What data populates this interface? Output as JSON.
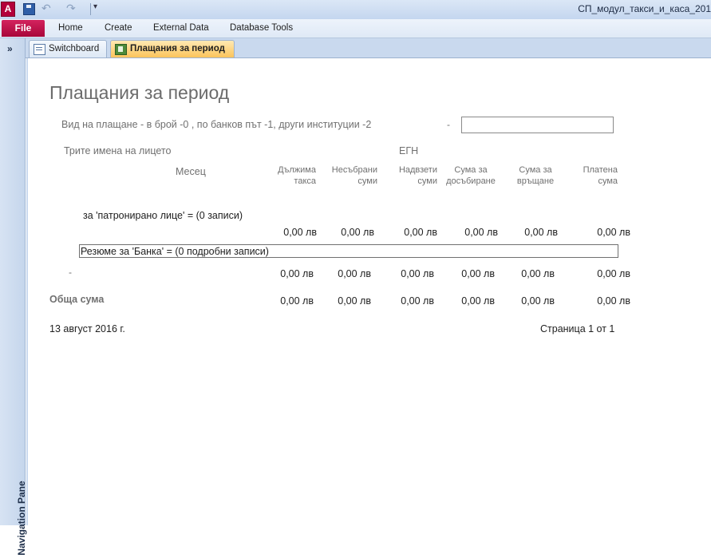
{
  "window": {
    "title": "СП_модул_такси_и_каса_201",
    "app_icon_letter": "A"
  },
  "quick_access": {
    "undo_glyph": "↶",
    "redo_glyph": "↷",
    "customize_glyph": "▾"
  },
  "ribbon": {
    "file_label": "File",
    "tabs": [
      "Home",
      "Create",
      "External Data",
      "Database Tools"
    ]
  },
  "nav_pane": {
    "label": "Navigation Pane",
    "toggle_glyph": "»"
  },
  "document_tabs": [
    {
      "label": "Switchboard",
      "active": false
    },
    {
      "label": "Плащания за период",
      "active": true
    }
  ],
  "report": {
    "title": "Плащания за период",
    "payment_type_label": "Вид на плащане - в брой -0 , по банков път -1, други институции -2",
    "payment_type_dash": "-",
    "payment_type_value": "",
    "columns": {
      "names": "Трите имена на лицето",
      "egn": "ЕГН",
      "month": "Месец",
      "due_line1": "Дължима",
      "due_line2": "такса",
      "uncollected_line1": "Несъбрани",
      "uncollected_line2": "суми",
      "overcharged_line1": "Надвзети",
      "overcharged_line2": "суми",
      "to_collect_line1": "Сума за",
      "to_collect_line2": "досъбиране",
      "to_return_line1": "Сума за",
      "to_return_line2": "връщане",
      "paid_line1": "Платена",
      "paid_line2": "сума"
    },
    "group_summary": "за 'патронирано лице' =  (0 записи)",
    "group_values": [
      "0,00 лв",
      "0,00 лв",
      "0,00 лв",
      "0,00 лв",
      "0,00 лв",
      "0,00 лв"
    ],
    "bank_summary": "Резюме за 'Банка' =  (0 подробни записи)",
    "bank_dash": "-",
    "bank_values": [
      "0,00 лв",
      "0,00 лв",
      "0,00 лв",
      "0,00 лв",
      "0,00 лв",
      "0,00 лв"
    ],
    "total_label": "Обща сума",
    "total_values": [
      "0,00 лв",
      "0,00 лв",
      "0,00 лв",
      "0,00 лв",
      "0,00 лв",
      "0,00 лв"
    ],
    "footer_date": "13 август 2016 г.",
    "footer_page": "Страница 1 от 1"
  },
  "colors": {
    "file_tab": "#b3003b",
    "active_doc_tab": "#fbc45b",
    "ribbon_bg": "#dfe9f6"
  }
}
